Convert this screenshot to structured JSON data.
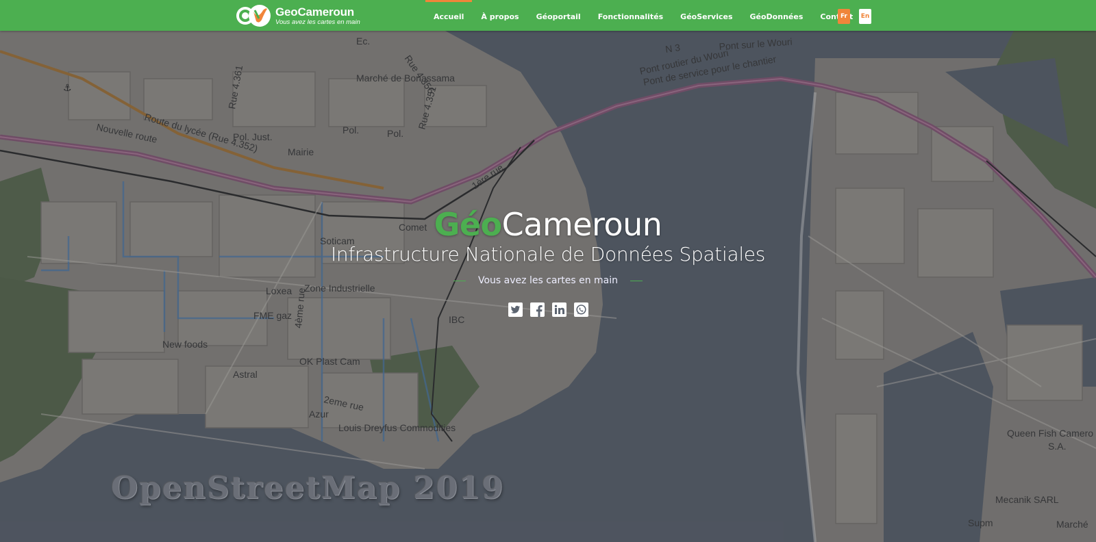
{
  "brand": {
    "name": "GeoCameroun",
    "tagline": "Vous avez les cartes en main"
  },
  "nav": {
    "items": [
      "Accueil",
      "À propos",
      "Géoportail",
      "Fonctionnalités",
      "GéoServices",
      "GéoDonnées",
      "Contact"
    ],
    "active": "Accueil"
  },
  "lang": {
    "fr": "Fr",
    "en": "En"
  },
  "hero": {
    "title_green": "Géo",
    "title_white": "Cameroun",
    "subtitle": "Infrastructure Nationale de Données Spatiales",
    "tagline": "Vous avez les cartes en main"
  },
  "social": [
    "twitter-icon",
    "facebook-icon",
    "linkedin-icon",
    "whatsapp-icon"
  ],
  "map": {
    "watermark": "OpenStreetMap  2019",
    "labels": {
      "marche": "Marché de Bonassama",
      "route_lycee": "Route du lycée (Rue 4.352)",
      "nouvelle_route": "Nouvelle route",
      "pol_just": "Pol. Just.",
      "mairie": "Mairie",
      "pol1": "Pol.",
      "pol2": "Pol.",
      "rue_4356": "Rue 4.356",
      "rue_4351": "Rue 4.351",
      "rue_4361": "Rue 4.361",
      "ec": "Ec.",
      "n3": "N 3",
      "pont_wouri": "Pont sur le Wouri",
      "pont_routier": "Pont routier du Wouri",
      "pont_service": "Pont de service pour le chantier",
      "tere_rue": "1ère rue",
      "comet": "Comet",
      "soticam": "Soticam",
      "loxea": "Loxea",
      "zone_industrielle": "Zone Industrielle",
      "rue_4eme": "4ème rue",
      "fme_gaz": "FME gaz",
      "ibc": "IBC",
      "new_foods": "New foods",
      "ok_plast": "OK Plast Cam",
      "astral": "Astral",
      "deme_rue": "2eme rue",
      "azur": "Azur",
      "louis_dreyfus": "Louis Dreyfus Commodities",
      "queen_fish": "Queen Fish Camero",
      "sa": "S.A.",
      "mecanik": "Mecanik SARL",
      "supm": "Supm",
      "marche_r": "Marché"
    }
  },
  "colors": {
    "header_green": "#4caf50",
    "accent_orange": "#f0853a",
    "water": "#5c6470",
    "land": "#8f8b86"
  }
}
